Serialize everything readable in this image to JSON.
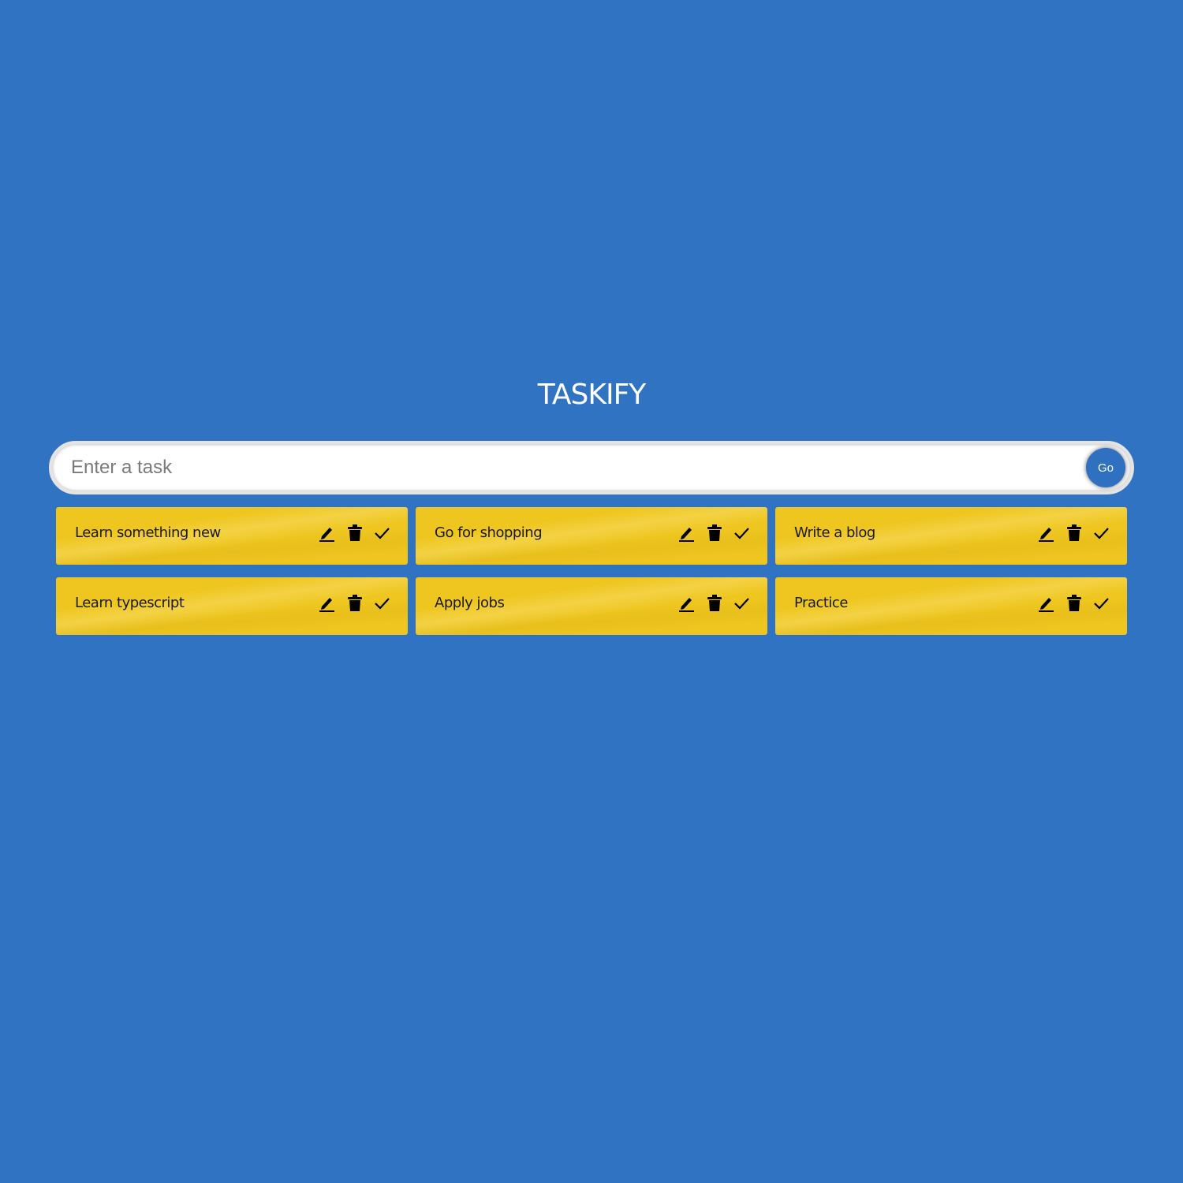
{
  "app": {
    "title": "TASKIFY"
  },
  "input": {
    "placeholder": "Enter a task",
    "value": ""
  },
  "go_button": {
    "label": "Go"
  },
  "tasks": [
    {
      "text": "Learn something new"
    },
    {
      "text": "Go for shopping"
    },
    {
      "text": "Write a blog"
    },
    {
      "text": "Learn typescript"
    },
    {
      "text": "Apply jobs"
    },
    {
      "text": "Practice"
    }
  ],
  "task_actions": [
    "edit-icon",
    "delete-icon",
    "done-icon"
  ],
  "colors": {
    "background": "#3073c2",
    "card": "#efc61f",
    "button": "#2f70c0",
    "title": "#ffffff"
  }
}
